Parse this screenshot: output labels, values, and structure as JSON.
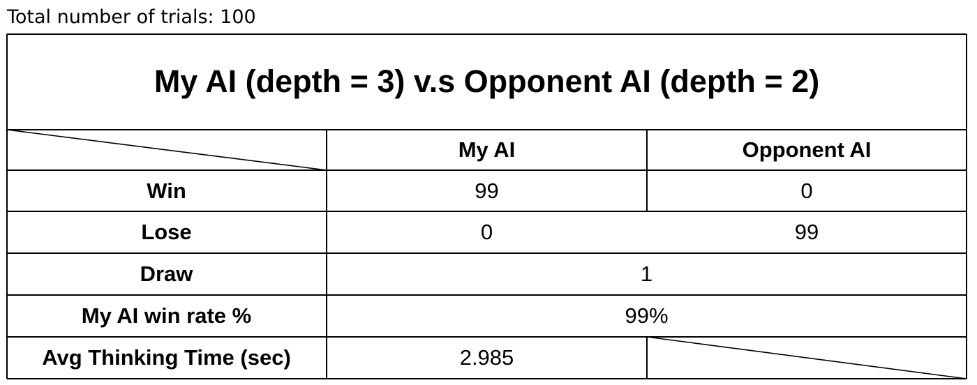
{
  "caption": "Total number of trials: 100",
  "table": {
    "title": "My AI (depth = 3)  v.s  Opponent AI (depth = 2)",
    "columns": [
      "My AI",
      "Opponent AI"
    ],
    "rows": {
      "win": {
        "label": "Win",
        "my_ai": "99",
        "opponent_ai": "0"
      },
      "lose": {
        "label": "Lose",
        "my_ai": "0",
        "opponent_ai": "99"
      },
      "draw": {
        "label": "Draw",
        "value": "1"
      },
      "win_rate": {
        "label": "My AI win rate %",
        "value": "99%"
      },
      "thinking_time": {
        "label": "Avg Thinking Time (sec)",
        "my_ai": "2.985"
      }
    }
  }
}
